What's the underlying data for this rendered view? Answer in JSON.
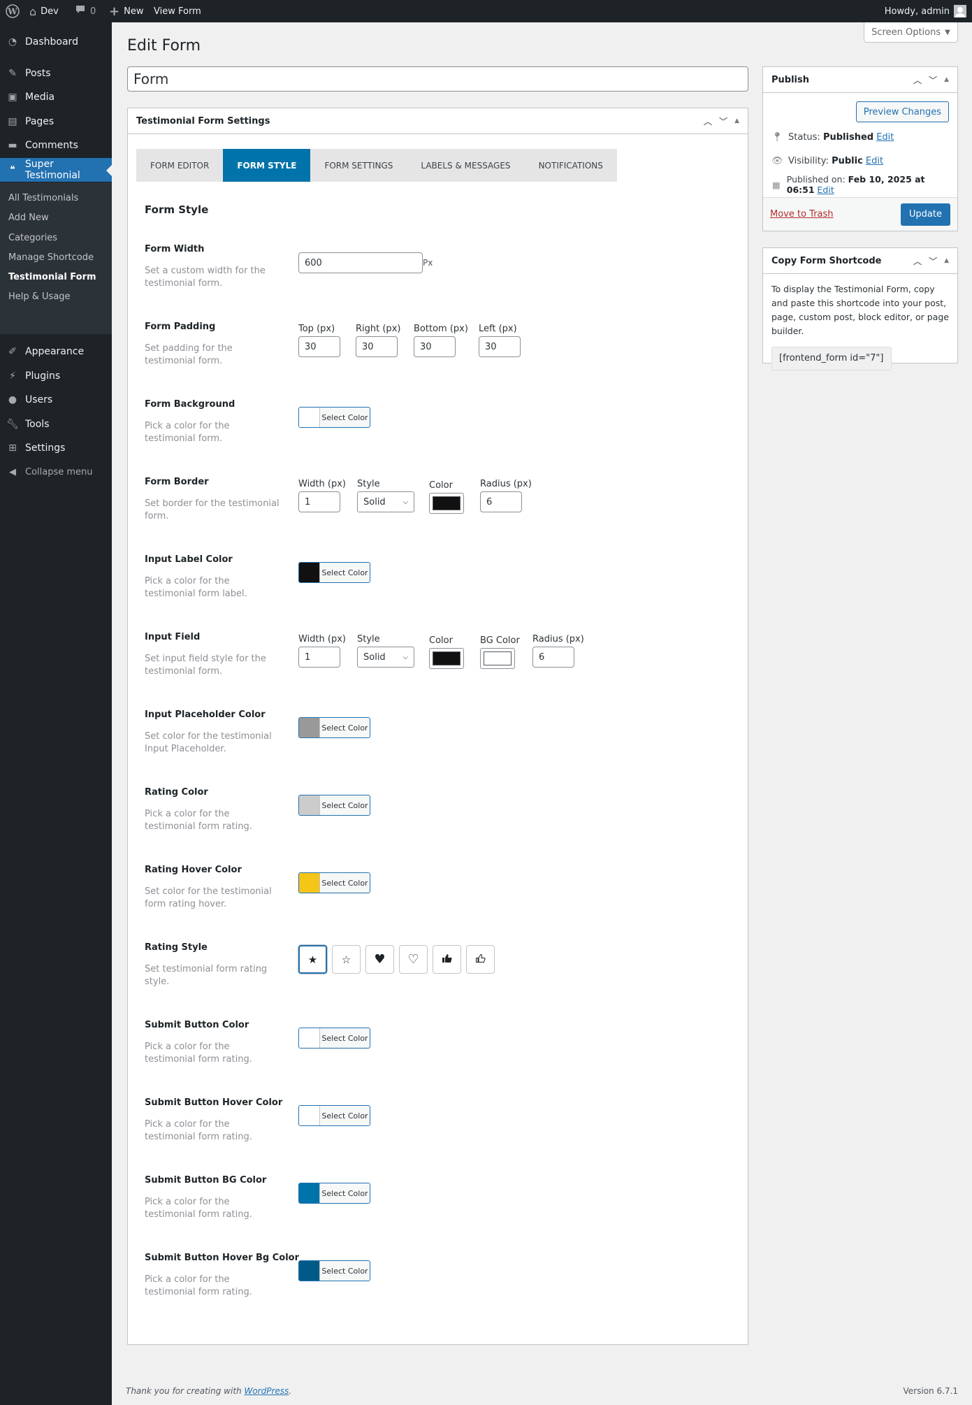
{
  "adminbar": {
    "site_name": "Dev",
    "comments_count": "0",
    "new_label": "New",
    "view_label": "View Form",
    "greeting": "Howdy, admin"
  },
  "sidebar": {
    "items": [
      {
        "label": "Dashboard",
        "icon": "dashboard-icon"
      },
      {
        "label": "Posts",
        "icon": "pin-icon"
      },
      {
        "label": "Media",
        "icon": "media-icon"
      },
      {
        "label": "Pages",
        "icon": "pages-icon"
      },
      {
        "label": "Comments",
        "icon": "comment-icon"
      },
      {
        "label": "Super Testimonial",
        "icon": "testimonial-icon"
      },
      {
        "label": "Appearance",
        "icon": "paintbrush-icon"
      },
      {
        "label": "Plugins",
        "icon": "plugin-icon"
      },
      {
        "label": "Users",
        "icon": "user-icon"
      },
      {
        "label": "Tools",
        "icon": "wrench-icon"
      },
      {
        "label": "Settings",
        "icon": "settings-icon"
      },
      {
        "label": "Collapse menu",
        "icon": "collapse-icon"
      }
    ],
    "submenu": [
      "All Testimonials",
      "Add New",
      "Categories",
      "Manage Shortcode",
      "Testimonial Form",
      "Help & Usage"
    ],
    "current_sub": "Testimonial Form"
  },
  "page": {
    "title": "Edit Form",
    "screen_options": "Screen Options",
    "post_title": "Form"
  },
  "settings_box": {
    "title": "Testimonial Form Settings",
    "tabs": [
      "Form Editor",
      "Form Style",
      "Form Settings",
      "Labels & Messages",
      "Notifications"
    ],
    "active_tab": "Form Style",
    "section_title": "Form Style",
    "select_color_label": "Select Color",
    "rows": {
      "form_width": {
        "label": "Form Width",
        "desc": "Set a custom width for the testimonial form.",
        "value": "600",
        "unit": "Px"
      },
      "form_padding": {
        "label": "Form Padding",
        "desc": "Set padding for the testimonial form.",
        "fields": [
          {
            "label": "Top (px)",
            "value": "30"
          },
          {
            "label": "Right (px)",
            "value": "30"
          },
          {
            "label": "Bottom (px)",
            "value": "30"
          },
          {
            "label": "Left (px)",
            "value": "30"
          }
        ]
      },
      "form_background": {
        "label": "Form Background",
        "desc": "Pick a color for the testimonial form.",
        "color": "#ffffff"
      },
      "form_border": {
        "label": "Form Border",
        "desc": "Set border for the testimonial form.",
        "width_label": "Width (px)",
        "width": "1",
        "style_label": "Style",
        "style": "Solid",
        "color_label": "Color",
        "color": "#111111",
        "radius_label": "Radius (px)",
        "radius": "6"
      },
      "input_label_color": {
        "label": "Input Label Color",
        "desc": "Pick a color for the testimonial form label.",
        "color": "#111111"
      },
      "input_field": {
        "label": "Input Field",
        "desc": "Set input field style for the testimonial form.",
        "width_label": "Width (px)",
        "width": "1",
        "style_label": "Style",
        "style": "Solid",
        "color_label": "Color",
        "color": "#111111",
        "bg_label": "BG Color",
        "bg_color": "#ffffff",
        "radius_label": "Radius (px)",
        "radius": "6"
      },
      "placeholder_color": {
        "label": "Input Placeholder Color",
        "desc": "Set color for the testimonial Input Placeholder.",
        "color": "#999999"
      },
      "rating_color": {
        "label": "Rating Color",
        "desc": "Pick a color for the testimonial form rating.",
        "color": "#cccccc"
      },
      "rating_hover_color": {
        "label": "Rating Hover Color",
        "desc": "Set color for the testimonial form rating hover.",
        "color": "#f5c518"
      },
      "rating_style": {
        "label": "Rating Style",
        "desc": "Set testimonial form rating style.",
        "options": [
          "star-solid",
          "star-outline",
          "heart-solid",
          "heart-outline",
          "thumb-solid",
          "thumb-outline"
        ],
        "glyphs": [
          "★",
          "☆",
          "♥",
          "♡",
          "👍",
          "👍"
        ],
        "selected": 0
      },
      "submit_color": {
        "label": "Submit Button Color",
        "desc": "Pick a color for the testimonial form rating.",
        "color": "#ffffff"
      },
      "submit_hover_color": {
        "label": "Submit Button Hover Color",
        "desc": "Pick a color for the testimonial form rating.",
        "color": "#ffffff"
      },
      "submit_bg_color": {
        "label": "Submit Button BG Color",
        "desc": "Pick a color for the testimonial form rating.",
        "color": "#0073aa"
      },
      "submit_hover_bg_color": {
        "label": "Submit Button Hover Bg Color",
        "desc": "Pick a color for the testimonial form rating.",
        "color": "#005a87"
      }
    }
  },
  "publish": {
    "title": "Publish",
    "preview_label": "Preview Changes",
    "status_label": "Status:",
    "status_value": "Published",
    "visibility_label": "Visibility:",
    "visibility_value": "Public",
    "published_label": "Published on:",
    "published_value": "Feb 10, 2025 at 06:51",
    "edit_label": "Edit",
    "trash_label": "Move to Trash",
    "update_label": "Update"
  },
  "shortcode_box": {
    "title": "Copy Form Shortcode",
    "description": "To display the Testimonial Form, copy and paste this shortcode into your post, page, custom post, block editor, or page builder.",
    "shortcode": "[frontend_form id=\"7\"]"
  },
  "footer": {
    "thanks": "Thank you for creating with ",
    "wp_link": "WordPress",
    "version": "Version 6.7.1"
  }
}
